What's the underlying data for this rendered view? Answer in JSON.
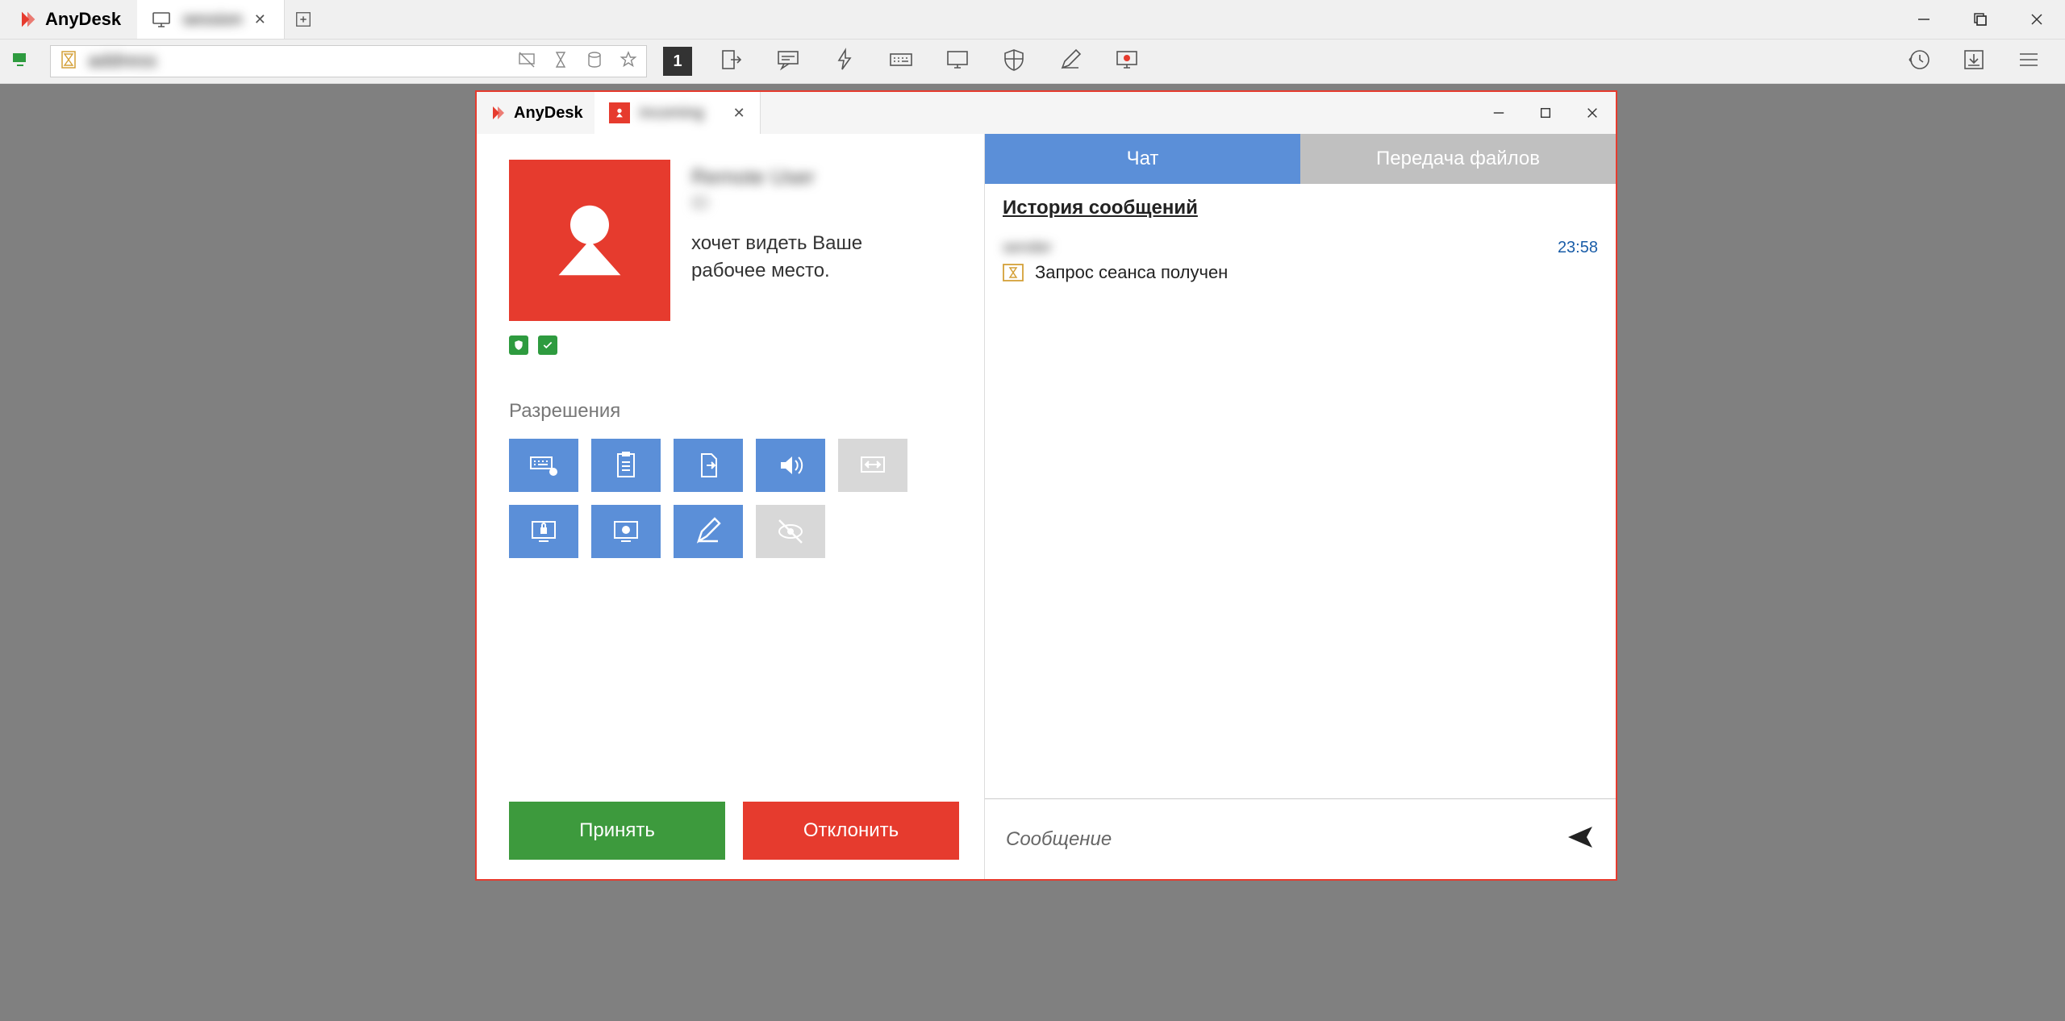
{
  "app": {
    "name": "AnyDesk"
  },
  "main_tab": {
    "label": "session"
  },
  "address_bar": {
    "value": "address"
  },
  "session_badge": "1",
  "dialog": {
    "app_name": "AnyDesk",
    "tab_label": "incoming",
    "user_name": "Remote User",
    "user_id": "ID",
    "request_line1": "хочет видеть Ваше",
    "request_line2": "рабочее место.",
    "permissions_title": "Разрешения",
    "accept": "Принять",
    "decline": "Отклонить"
  },
  "chat": {
    "tab_chat": "Чат",
    "tab_files": "Передача файлов",
    "history_title": "История сообщений",
    "msg_from": "sender",
    "msg_time": "23:58",
    "msg_text": "Запрос сеанса получен",
    "placeholder": "Сообщение"
  }
}
